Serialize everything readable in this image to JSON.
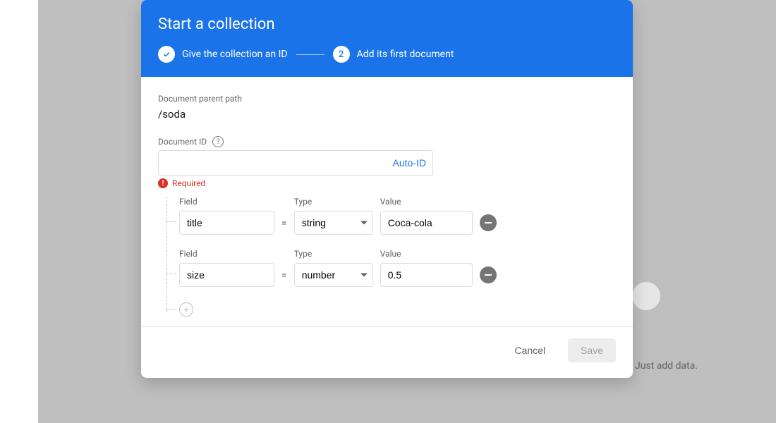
{
  "bg": {
    "hint": "Just add data."
  },
  "header": {
    "title": "Start a collection",
    "step1": "Give the collection an ID",
    "step2_num": "2",
    "step2": "Add its first document"
  },
  "body": {
    "parent_label": "Document parent path",
    "parent_value": "/soda",
    "docid_label": "Document ID",
    "autoid": "Auto-ID",
    "docid_value": "",
    "error_text": "Required",
    "col_field": "Field",
    "col_type": "Type",
    "col_value": "Value",
    "rows": [
      {
        "field": "title",
        "type": "string",
        "value": "Coca-cola"
      },
      {
        "field": "size",
        "type": "number",
        "value": "0.5"
      }
    ]
  },
  "footer": {
    "cancel": "Cancel",
    "save": "Save"
  }
}
